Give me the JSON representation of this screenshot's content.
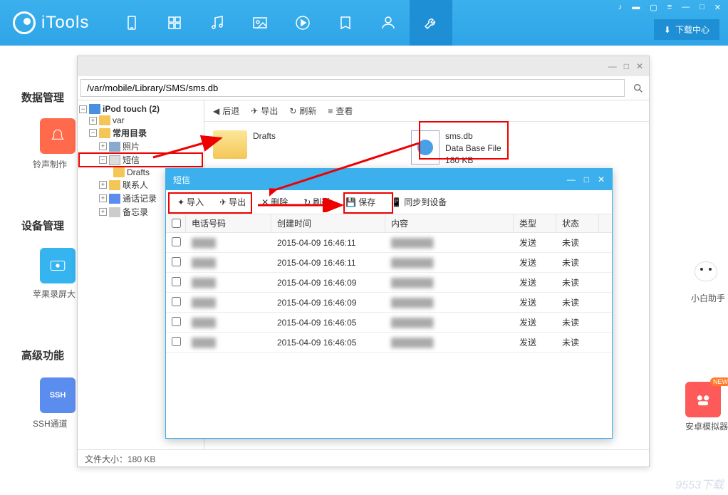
{
  "app": {
    "name": "iTools",
    "download_center": "下载中心"
  },
  "side": {
    "sections": [
      "数据管理",
      "设备管理",
      "高级功能"
    ],
    "tiles": {
      "ring": "铃声制作",
      "screen": "苹果录屏大",
      "ssh": "SSH通道",
      "assistant": "小白助手",
      "emulator": "安卓模拟器",
      "new_badge": "NEW"
    }
  },
  "filebrowser": {
    "path": "/var/mobile/Library/SMS/sms.db",
    "toolbar": {
      "back": "后退",
      "export": "导出",
      "refresh": "刷新",
      "view": "查看"
    },
    "tree": {
      "root": "iPod touch (2)",
      "var": "var",
      "common": "常用目录",
      "photos": "照片",
      "sms": "短信",
      "drafts": "Drafts",
      "contacts": "联系人",
      "calllog": "通话记录",
      "notes": "备忘录"
    },
    "files": {
      "drafts": "Drafts",
      "smsdb": {
        "name": "sms.db",
        "type": "Data Base File",
        "size": "180 KB"
      }
    },
    "status": "文件大小：180 KB"
  },
  "sms": {
    "title": "短信",
    "toolbar": {
      "import": "导入",
      "export": "导出",
      "delete": "删除",
      "refresh": "刷新",
      "save": "保存",
      "sync": "同步到设备"
    },
    "columns": {
      "phone": "电话号码",
      "time": "创建时间",
      "content": "内容",
      "type": "类型",
      "status": "状态"
    },
    "rows": [
      {
        "time": "2015-04-09 16:46:11",
        "type": "发送",
        "status": "未读"
      },
      {
        "time": "2015-04-09 16:46:11",
        "type": "发送",
        "status": "未读"
      },
      {
        "time": "2015-04-09 16:46:09",
        "type": "发送",
        "status": "未读"
      },
      {
        "time": "2015-04-09 16:46:09",
        "type": "发送",
        "status": "未读"
      },
      {
        "time": "2015-04-09 16:46:05",
        "type": "发送",
        "status": "未读"
      },
      {
        "time": "2015-04-09 16:46:05",
        "type": "发送",
        "status": "未读"
      }
    ]
  },
  "watermark": "9553下载"
}
